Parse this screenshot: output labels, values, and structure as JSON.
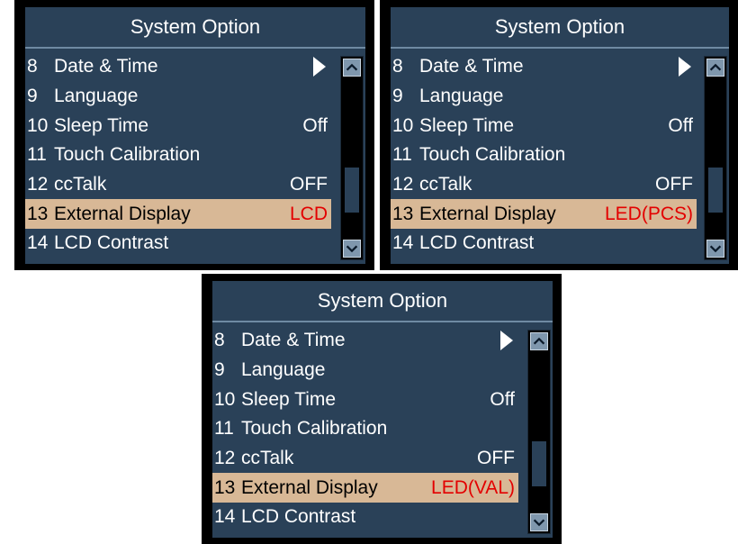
{
  "panels": [
    {
      "title": "System Option",
      "items": [
        {
          "num": "8",
          "label": "Date & Time",
          "value": ""
        },
        {
          "num": "9",
          "label": "Language",
          "value": ""
        },
        {
          "num": "10",
          "label": "Sleep Time",
          "value": "Off"
        },
        {
          "num": "11",
          "label": "Touch Calibration",
          "value": ""
        },
        {
          "num": "12",
          "label": "ccTalk",
          "value": "OFF"
        },
        {
          "num": "13",
          "label": "External Display",
          "value": "LCD"
        },
        {
          "num": "14",
          "label": "LCD Contrast",
          "value": ""
        }
      ]
    },
    {
      "title": "System Option",
      "items": [
        {
          "num": "8",
          "label": "Date & Time",
          "value": ""
        },
        {
          "num": "9",
          "label": "Language",
          "value": ""
        },
        {
          "num": "10",
          "label": "Sleep Time",
          "value": "Off"
        },
        {
          "num": "11",
          "label": "Touch Calibration",
          "value": ""
        },
        {
          "num": "12",
          "label": "ccTalk",
          "value": "OFF"
        },
        {
          "num": "13",
          "label": "External Display",
          "value": "LED(PCS)"
        },
        {
          "num": "14",
          "label": "LCD Contrast",
          "value": ""
        }
      ]
    },
    {
      "title": "System Option",
      "items": [
        {
          "num": "8",
          "label": "Date & Time",
          "value": ""
        },
        {
          "num": "9",
          "label": "Language",
          "value": ""
        },
        {
          "num": "10",
          "label": "Sleep Time",
          "value": "Off"
        },
        {
          "num": "11",
          "label": "Touch Calibration",
          "value": ""
        },
        {
          "num": "12",
          "label": "ccTalk",
          "value": "OFF"
        },
        {
          "num": "13",
          "label": "External Display",
          "value": "LED(VAL)"
        },
        {
          "num": "14",
          "label": "LCD Contrast",
          "value": ""
        }
      ]
    }
  ],
  "selected_index": 5,
  "submenu_index": 0,
  "icons": {
    "submenu": "chevron-right-icon",
    "scroll_up": "scroll-up-icon",
    "scroll_down": "scroll-down-icon"
  },
  "colors": {
    "screen_bg": "#2a4158",
    "selected_bg": "#d8b896",
    "selected_value": "#e30000",
    "text": "#ffffff"
  }
}
